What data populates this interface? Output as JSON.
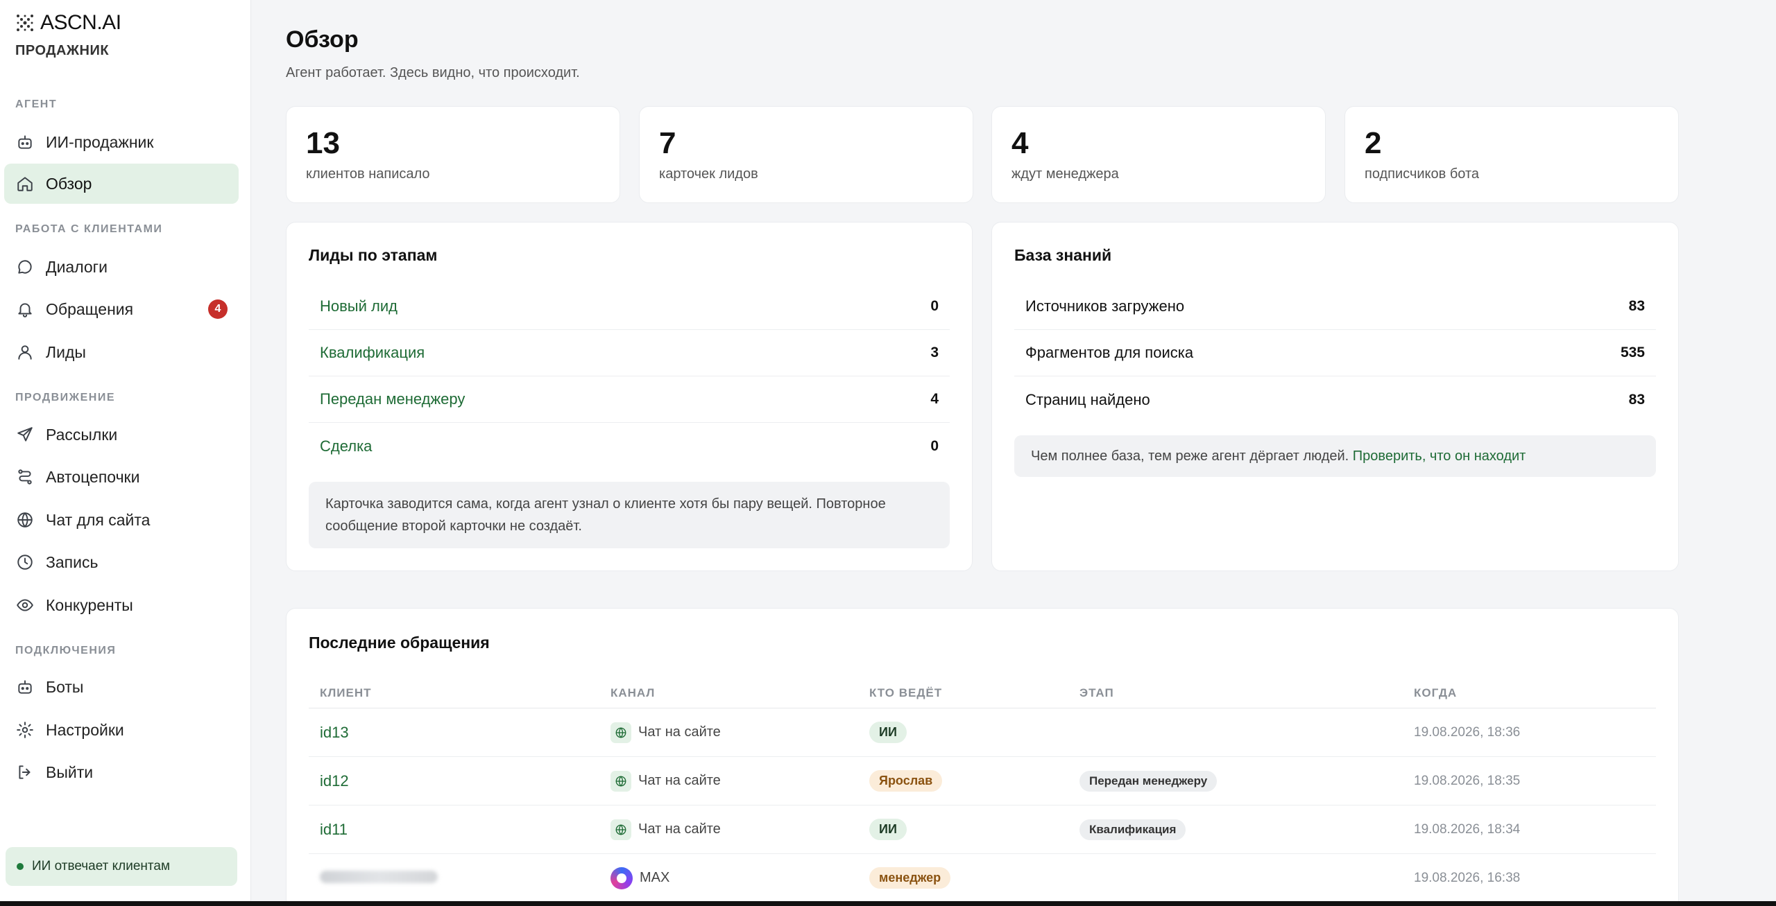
{
  "brand": {
    "name": "ASCN.AI",
    "subtitle": "ПРОДАЖНИК"
  },
  "sidebar": {
    "sections": {
      "agent": "АГЕНТ",
      "clients": "РАБОТА С КЛИЕНТАМИ",
      "promo": "ПРОДВИЖЕНИЕ",
      "connections": "ПОДКЛЮЧЕНИЯ"
    },
    "items": [
      {
        "label": "ИИ-продажник",
        "icon": "robot-icon"
      },
      {
        "label": "Обзор",
        "icon": "home-icon",
        "active": true
      },
      {
        "label": "Диалоги",
        "icon": "chat-icon"
      },
      {
        "label": "Обращения",
        "icon": "bell-icon",
        "badge": "4"
      },
      {
        "label": "Лиды",
        "icon": "user-icon"
      },
      {
        "label": "Рассылки",
        "icon": "send-icon"
      },
      {
        "label": "Автоцепочки",
        "icon": "route-icon"
      },
      {
        "label": "Чат для сайта",
        "icon": "globe-icon"
      },
      {
        "label": "Запись",
        "icon": "clock-icon"
      },
      {
        "label": "Конкуренты",
        "icon": "eye-icon"
      },
      {
        "label": "Боты",
        "icon": "robot-icon"
      },
      {
        "label": "Настройки",
        "icon": "gear-icon"
      },
      {
        "label": "Выйти",
        "icon": "logout-icon"
      }
    ],
    "status": "ИИ отвечает клиентам"
  },
  "header": {
    "title": "Обзор",
    "subtitle": "Агент работает. Здесь видно, что происходит."
  },
  "stats": [
    {
      "value": "13",
      "label": "клиентов написало"
    },
    {
      "value": "7",
      "label": "карточек лидов"
    },
    {
      "value": "4",
      "label": "ждут менеджера"
    },
    {
      "value": "2",
      "label": "подписчиков бота"
    }
  ],
  "leads": {
    "title": "Лиды по этапам",
    "rows": [
      {
        "label": "Новый лид",
        "value": "0"
      },
      {
        "label": "Квалификация",
        "value": "3"
      },
      {
        "label": "Передан менеджеру",
        "value": "4"
      },
      {
        "label": "Сделка",
        "value": "0"
      }
    ],
    "note": "Карточка заводится сама, когда агент узнал о клиенте хотя бы пару вещей. Повторное сообщение второй карточки не создаёт."
  },
  "kb": {
    "title": "База знаний",
    "rows": [
      {
        "label": "Источников загружено",
        "value": "83"
      },
      {
        "label": "Фрагментов для поиска",
        "value": "535"
      },
      {
        "label": "Страниц найдено",
        "value": "83"
      }
    ],
    "note": "Чем полнее база, тем реже агент дёргает людей.",
    "note_link": "Проверить, что он находит"
  },
  "recent": {
    "title": "Последние обращения",
    "columns": [
      "КЛИЕНТ",
      "КАНАЛ",
      "КТО ВЕДЁТ",
      "ЭТАП",
      "КОГДА"
    ],
    "rows": [
      {
        "client": "id13",
        "channel": "Чат на сайте",
        "owner": "ИИ",
        "stage": "",
        "when": "19.08.2026, 18:36"
      },
      {
        "client": "id12",
        "channel": "Чат на сайте",
        "owner": "Ярослав",
        "stage": "Передан менеджеру",
        "when": "19.08.2026, 18:35"
      },
      {
        "client": "id11",
        "channel": "Чат на сайте",
        "owner": "ИИ",
        "stage": "Квалификация",
        "when": "19.08.2026, 18:34"
      },
      {
        "client": "",
        "channel": "MAX",
        "owner": "менеджер",
        "stage": "",
        "when": "19.08.2026, 16:38"
      }
    ]
  },
  "colors": {
    "accent": "#1e6b35",
    "active_bg": "#e3f1e6",
    "badge": "#c62f2a"
  }
}
